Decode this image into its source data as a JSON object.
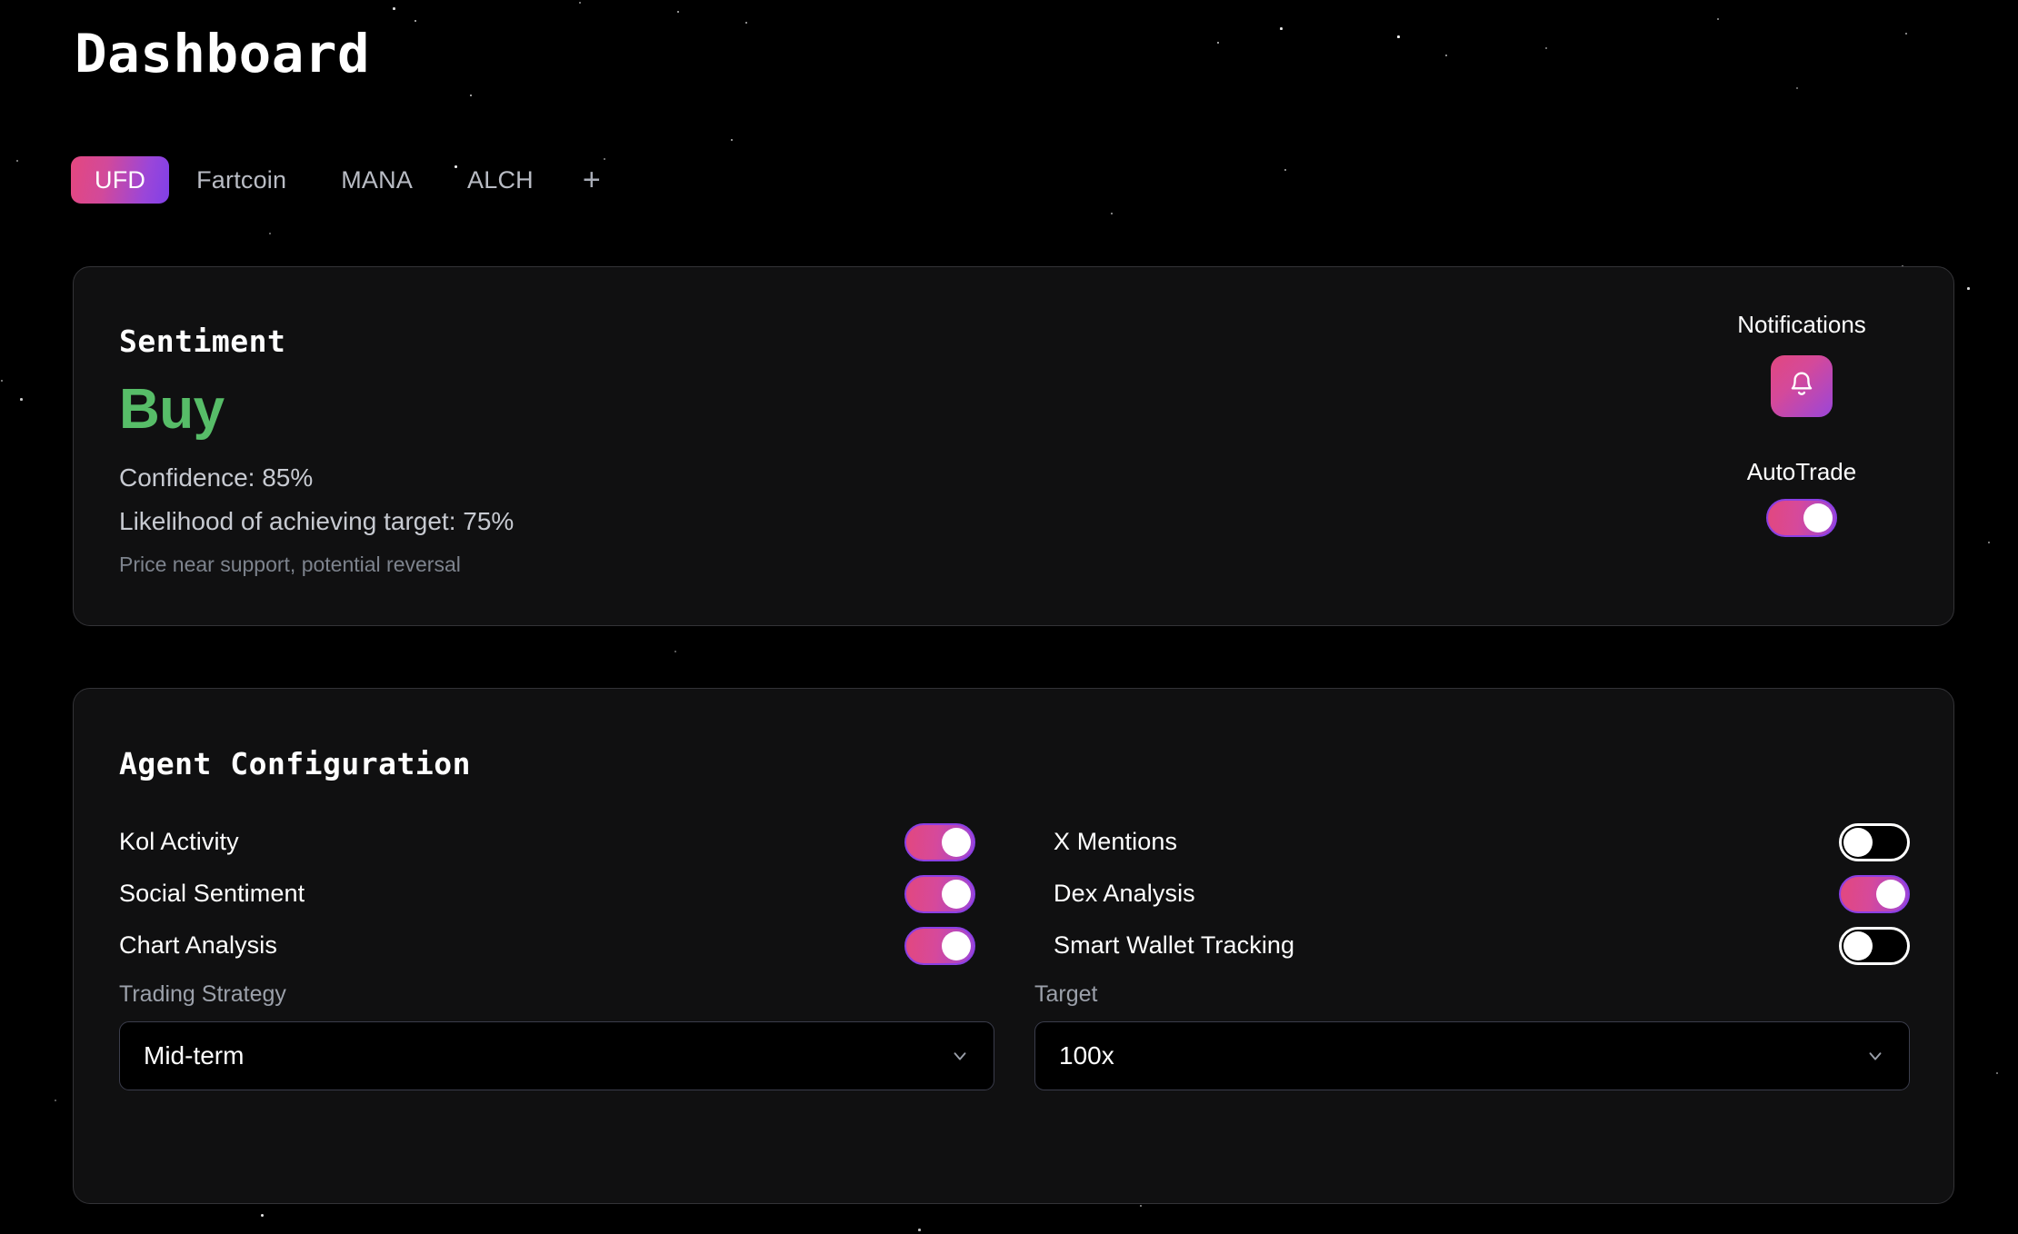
{
  "header": {
    "title": "Dashboard"
  },
  "tabs": {
    "items": [
      {
        "label": "UFD",
        "active": true
      },
      {
        "label": "Fartcoin",
        "active": false
      },
      {
        "label": "MANA",
        "active": false
      },
      {
        "label": "ALCH",
        "active": false
      }
    ],
    "add_label": "+",
    "add_icon": "plus-icon"
  },
  "sentiment": {
    "title": "Sentiment",
    "verdict": "Buy",
    "verdict_color": "#57bd68",
    "confidence": "Confidence: 85%",
    "likelihood": "Likelihood of achieving target: 75%",
    "note": "Price near support, potential reversal",
    "notifications": {
      "label": "Notifications",
      "icon": "bell-icon"
    },
    "autotrade": {
      "label": "AutoTrade",
      "state": "on"
    }
  },
  "agent": {
    "title": "Agent Configuration",
    "features": [
      {
        "label": "Kol Activity",
        "state": "on"
      },
      {
        "label": "X Mentions",
        "state": "off"
      },
      {
        "label": "Social Sentiment",
        "state": "on"
      },
      {
        "label": "Dex Analysis",
        "state": "on"
      },
      {
        "label": "Chart Analysis",
        "state": "on"
      },
      {
        "label": "Smart Wallet Tracking",
        "state": "off"
      }
    ],
    "strategy": {
      "label": "Trading Strategy",
      "value": "Mid-term",
      "icon": "chevron-down-icon"
    },
    "target": {
      "label": "Target",
      "value": "100x",
      "icon": "chevron-down-icon"
    }
  },
  "theme": {
    "background": "#000000",
    "card_background": "#101011",
    "card_border": "#333337",
    "accent_pink": "#e2487f",
    "accent_purple": "#8b3fe3",
    "positive_green": "#57bd68"
  }
}
